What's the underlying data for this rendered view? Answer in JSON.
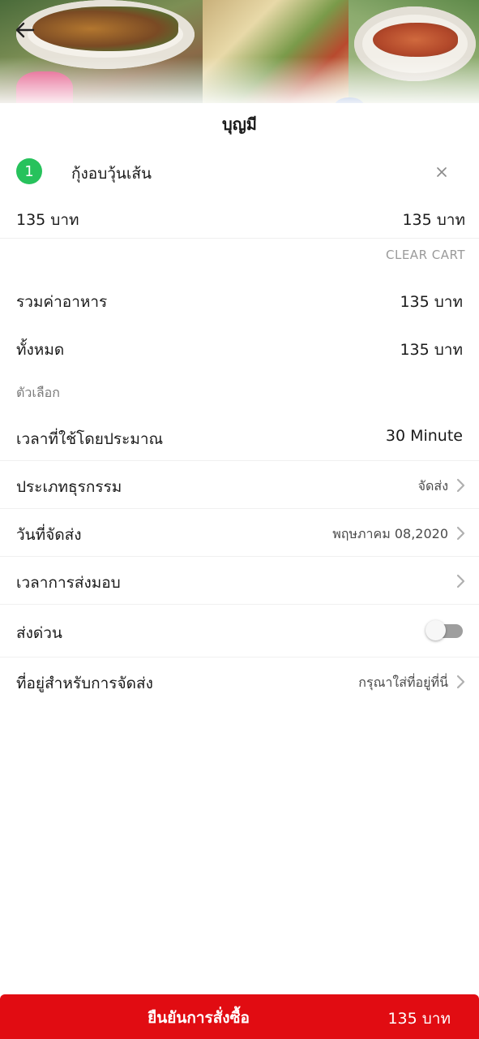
{
  "header": {
    "back_icon": "arrow-left-icon",
    "shop_name": "บุญมี"
  },
  "cart": {
    "item": {
      "quantity": "1",
      "name": "กุ้งอบวุ้นเส้น",
      "remove_icon": "close-icon",
      "unit_price": "135 บาท",
      "line_total": "135 บาท"
    },
    "clear_cart_label": "CLEAR CART"
  },
  "summary": {
    "food_total_label": "รวมค่าอาหาร",
    "food_total_value": "135 บาท",
    "grand_total_label": "ทั้งหมด",
    "grand_total_value": "135 บาท"
  },
  "options": {
    "heading": "ตัวเลือก",
    "estimated_time_label": "เวลาที่ใช้โดยประมาณ",
    "estimated_time_value": "30 Minute",
    "business_type_label": "ประเภทธุรกรรม",
    "business_type_value": "จัดส่ง",
    "delivery_date_label": "วันที่จัดส่ง",
    "delivery_date_value": "พฤษภาคม 08,2020",
    "delivery_time_label": "เวลาการส่งมอบ",
    "express_label": "ส่งด่วน",
    "express_enabled": false,
    "address_label": "ที่อยู่สำหรับการจัดส่ง",
    "address_placeholder": "กรุณาใส่ที่อยู่ที่นี่",
    "chevron_icon": "chevron-right-icon"
  },
  "confirm": {
    "label": "ยืนยันการสั่งซื้อ",
    "price": "135 บาท"
  },
  "colors": {
    "accent_red": "#e10c12",
    "badge_green": "#27c25c",
    "toggle_off": "#9e9e9e"
  }
}
